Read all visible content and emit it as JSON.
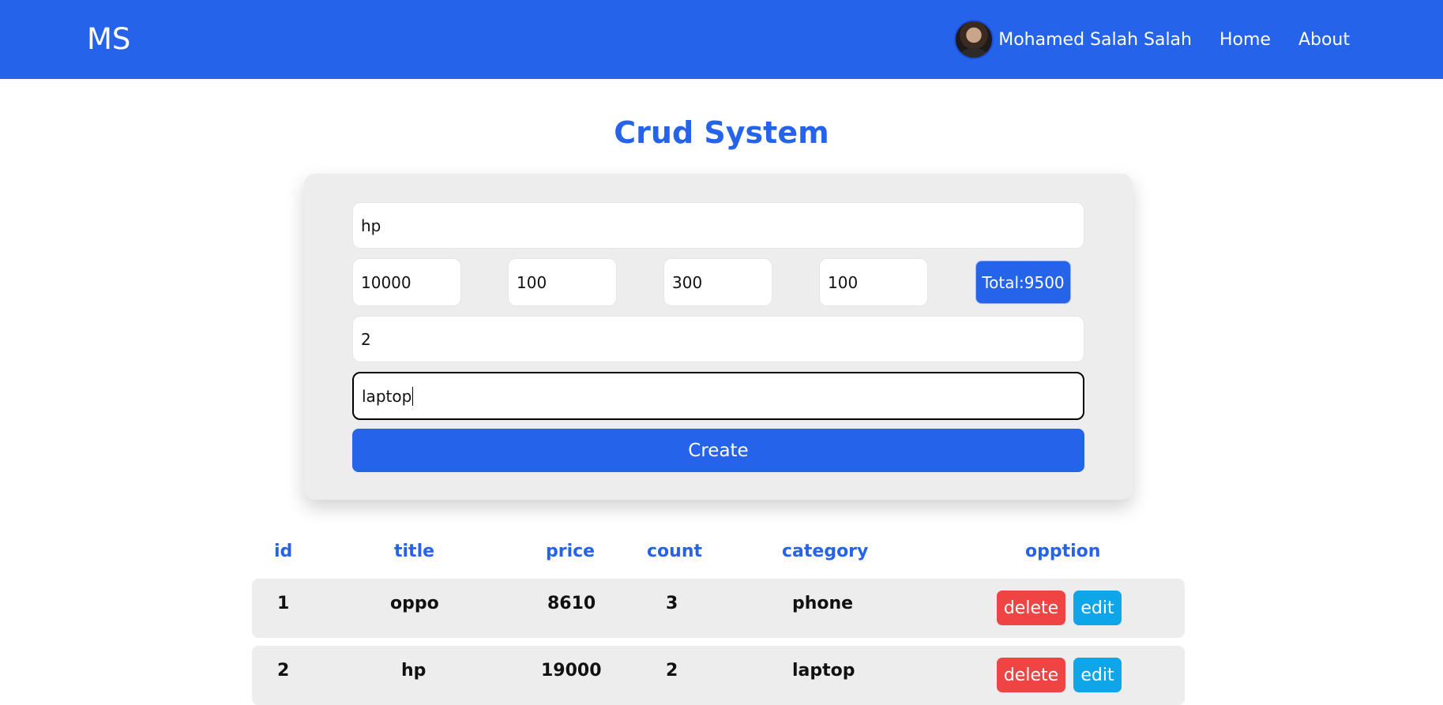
{
  "navbar": {
    "logo": "MS",
    "user_name": "Mohamed Salah Salah",
    "links": [
      "Home",
      "About"
    ]
  },
  "title": "Crud System",
  "form": {
    "title_value": "hp",
    "price_value": "10000",
    "taxes_value": "100",
    "ads_value": "300",
    "discount_value": "100",
    "total_label": "Total:9500",
    "count_value": "2",
    "category_value": "laptop",
    "create_label": "Create"
  },
  "table": {
    "headers": [
      "id",
      "title",
      "price",
      "count",
      "category",
      "opption"
    ],
    "rows": [
      {
        "id": "1",
        "title": "oppo",
        "price": "8610",
        "count": "3",
        "category": "phone"
      },
      {
        "id": "2",
        "title": "hp",
        "price": "19000",
        "count": "2",
        "category": "laptop"
      }
    ],
    "delete_label": "delete",
    "edit_label": "edit"
  },
  "colors": {
    "primary": "#2563eb",
    "delete": "#ef4444",
    "edit": "#0ea5e9",
    "card": "#ededed"
  }
}
